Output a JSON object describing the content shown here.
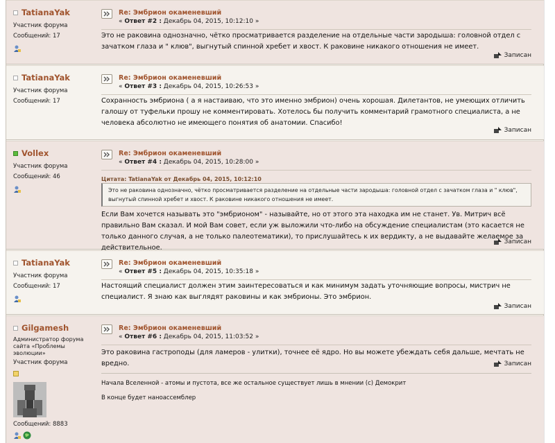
{
  "posts": [
    {
      "username": "TatianaYak",
      "online": false,
      "role": "Участник форума",
      "messages_label": "Сообщений: 17",
      "subject": "Re: Эмбрион окаменевший",
      "reply_prefix": "« ",
      "reply_label": "Ответ #2 :",
      "reply_date": " Декабрь 04, 2015, 10:12:10 »",
      "body": "Это не раковина однозначно, чётко просматривается разделение на отдельные части зародыша: головной отдел с зачатком глаза и \" клюв\", выгнутый спинной хребет и хвост. К раковине никакого отношения не имеет.",
      "saved_label": "Записан"
    },
    {
      "username": "TatianaYak",
      "online": false,
      "role": "Участник форума",
      "messages_label": "Сообщений: 17",
      "subject": "Re: Эмбрион окаменевший",
      "reply_prefix": "« ",
      "reply_label": "Ответ #3 :",
      "reply_date": " Декабрь 04, 2015, 10:26:53 »",
      "body": "Сохранность эмбриона ( а я настаиваю, что это именно эмбрион) очень хорошая. Дилетантов, не умеющих отличить галошу от туфельки прошу не комментировать. Хотелось бы получить комментарий грамотного специалиста, а не человека абсолютно не имеющего понятия об анатомии. Спасибо!",
      "saved_label": "Записан"
    },
    {
      "username": "Vollex",
      "online": true,
      "role": "Участник форума",
      "messages_label": "Сообщений: 46",
      "subject": "Re: Эмбрион окаменевший",
      "reply_prefix": "« ",
      "reply_label": "Ответ #4 :",
      "reply_date": " Декабрь 04, 2015, 10:28:00 »",
      "quote_header": "Цитата: TatianaYak от Декабрь 04, 2015, 10:12:10",
      "quote_text": "Это не раковина однозначно, чётко просматривается разделение на отдельные части зародыша: головной отдел с зачатком глаза и \" клюв\", выгнутый спинной хребет и хвост. К раковине никакого отношения не имеет.",
      "body": "Если Вам хочется называть это \"эмбрионом\" - называйте, но от этого эта находка им не станет. Ув. Митрич всё правильно Вам сказал. И мой Вам совет, если уж выложили что-либо на обсуждение специалистам (это касается не только данного случая, а не только палеотематики), то прислушайтесь к их вердикту, а не выдавайте желаемое за действительное.",
      "saved_label": "Записан"
    },
    {
      "username": "TatianaYak",
      "online": false,
      "role": "Участник форума",
      "messages_label": "Сообщений: 17",
      "subject": "Re: Эмбрион окаменевший",
      "reply_prefix": "« ",
      "reply_label": "Ответ #5 :",
      "reply_date": " Декабрь 04, 2015, 10:35:18 »",
      "body": "Настоящий специалист должен этим заинтересоваться и как минимум задать уточняющие вопросы, мистрич не специалист. Я знаю как выглядят раковины и как эмбрионы. Это эмбрион.",
      "saved_label": "Записан"
    },
    {
      "username": "Gilgamesh",
      "online": false,
      "role": "Администратор форума сайта «Проблемы эволюции»",
      "role2": "Участник форума",
      "messages_label": "Сообщений: 8883",
      "subject": "Re: Эмбрион окаменевший",
      "reply_prefix": "« ",
      "reply_label": "Ответ #6 :",
      "reply_date": " Декабрь 04, 2015, 11:03:52 »",
      "body": "Это раковина гастроподы (для ламеров - улитки), точнее её ядро. Но вы можете убеждать себя дальше, мечтать не вредно.",
      "saved_label": "Записан",
      "signature_line1": "Начала Вселенной - атомы и пустота, все же остальное существует лишь в мнении (с) Демокрит",
      "signature_line2": "В конце будет наноассемблер"
    }
  ],
  "colors": {
    "username": "#a0542e",
    "post_odd_bg": "#efe4e0",
    "post_even_bg": "#f6f3ee",
    "online_dot": "#5cbc3e"
  },
  "icons": [
    "status-icon",
    "profile-icon",
    "post-icon",
    "saved-icon",
    "avatar",
    "star-icon",
    "globe-icon"
  ]
}
